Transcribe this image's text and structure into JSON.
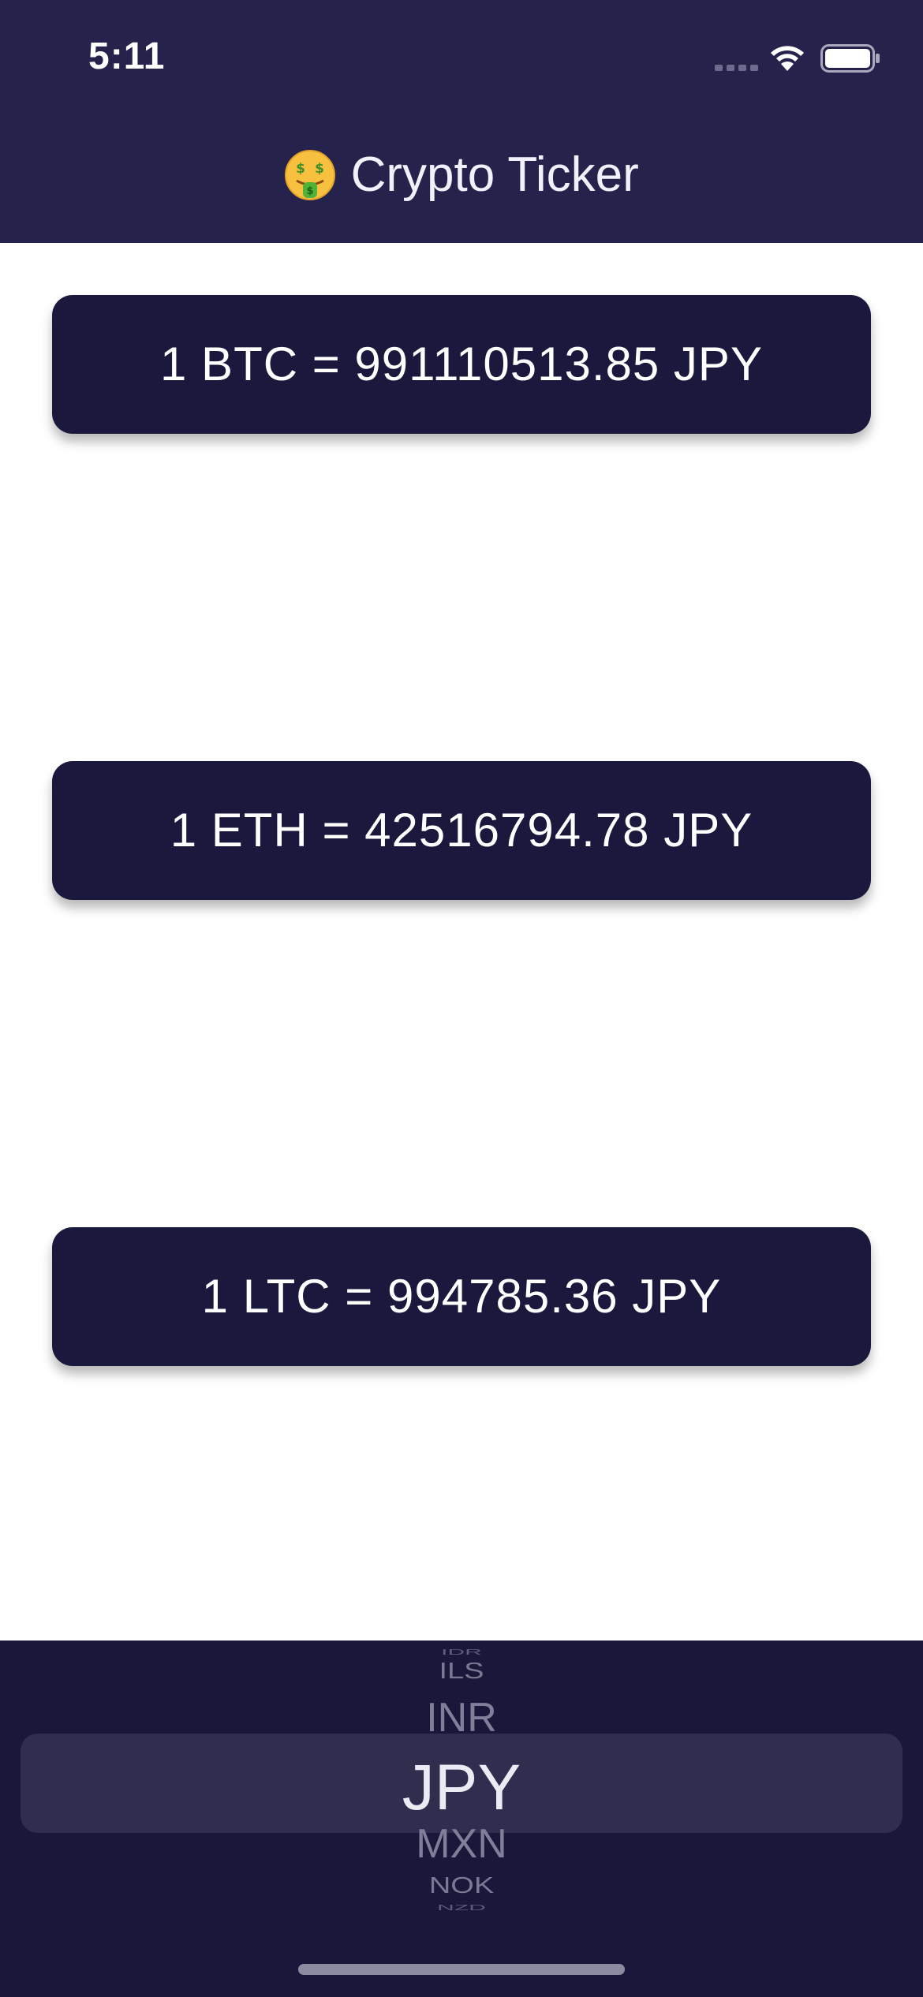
{
  "status_bar": {
    "time": "5:11",
    "signal_icon": "signal-dots-icon",
    "wifi_icon": "wifi-icon",
    "battery_icon": "battery-icon"
  },
  "header": {
    "emoji_icon": "money-mouth-face-icon",
    "title": "Crypto Ticker"
  },
  "rates": [
    {
      "label": "1 BTC = 991110513.85 JPY"
    },
    {
      "label": "1 ETH = 42516794.78 JPY"
    },
    {
      "label": "1 LTC = 994785.36 JPY"
    }
  ],
  "picker": {
    "options_above": [
      "IDR",
      "ILS",
      "INR"
    ],
    "selected": "JPY",
    "options_below": [
      "MXN",
      "NOK",
      "NZD"
    ]
  },
  "colors": {
    "header_bg": "#25234b",
    "card_bg": "#1a183d",
    "picker_bg": "#19183a"
  }
}
